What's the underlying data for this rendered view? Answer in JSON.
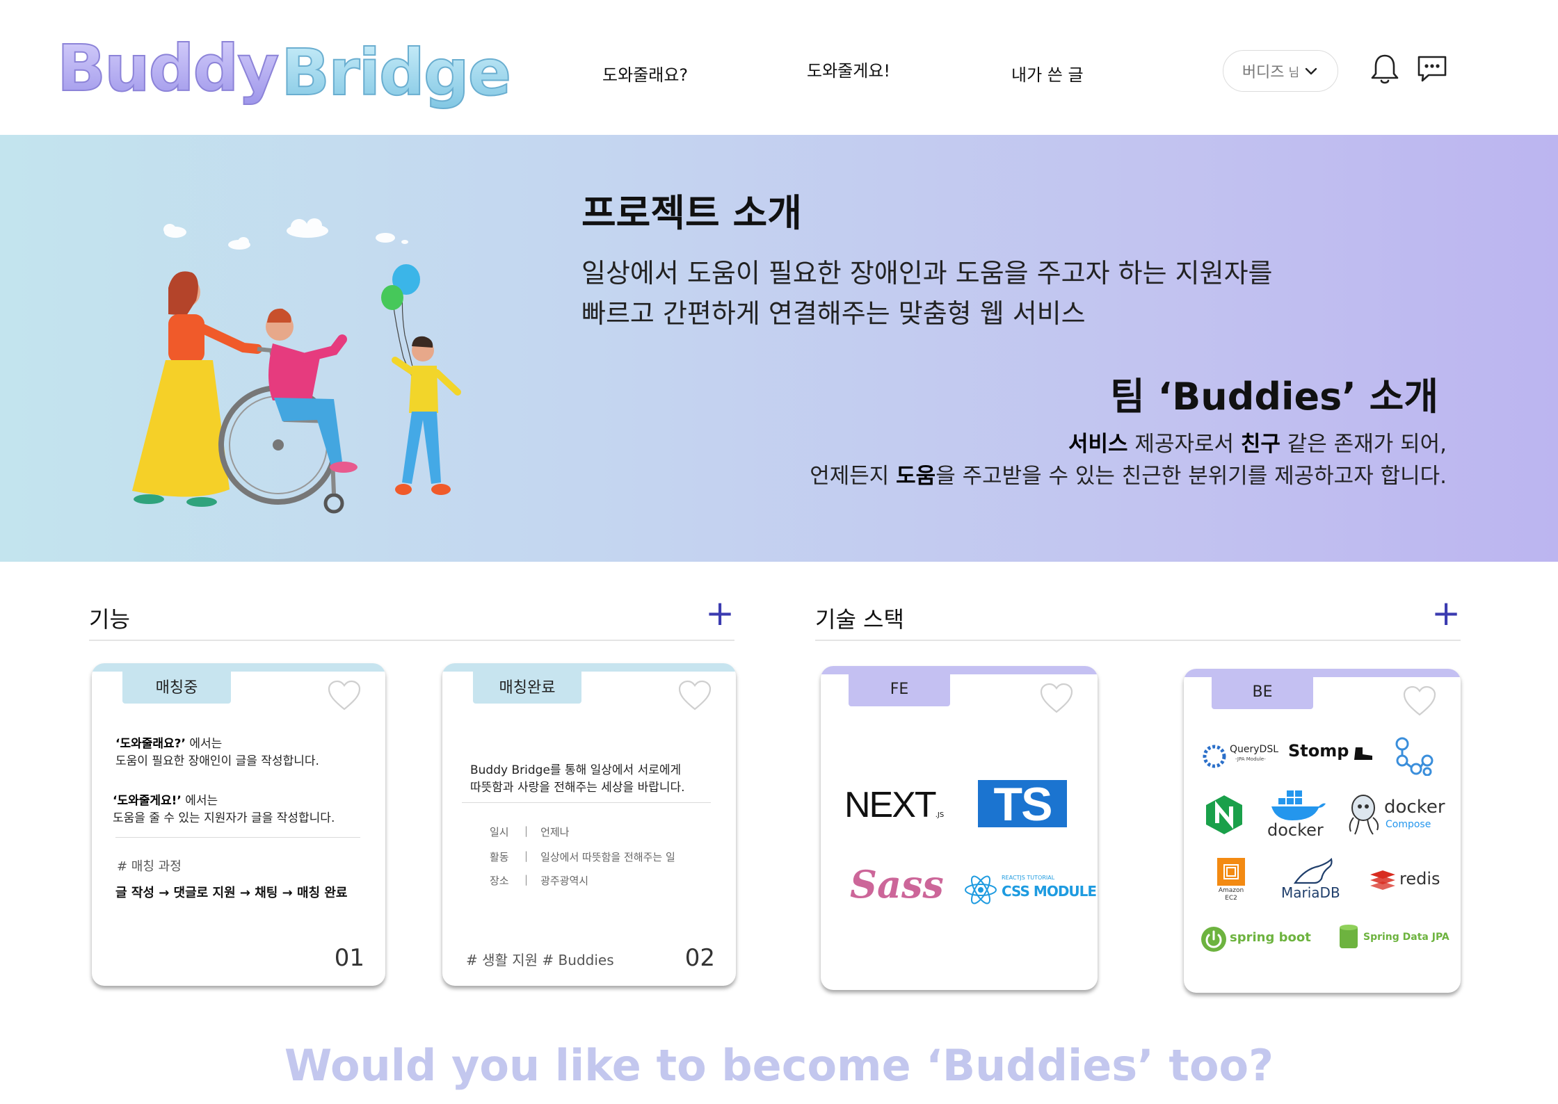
{
  "header": {
    "logo_text": "Buddy Bridge",
    "nav": [
      "도와줄래요?",
      "도와줄게요!",
      "내가 쓴 글"
    ],
    "user_label": "버디즈",
    "user_suffix": "님"
  },
  "hero": {
    "title": "프로젝트 소개",
    "desc_line1": "일상에서 도움이 필요한 장애인과 도움을 주고자 하는 지원자를",
    "desc_line2": "빠르고 간편하게 연결해주는 맞춤형 웹 서비스",
    "team_title": "팀 ‘Buddies’ 소개",
    "team_line1_b1": "서비스",
    "team_line1_t1": " 제공자로서 ",
    "team_line1_b2": "친구",
    "team_line1_t2": " 같은 존재가 되어,",
    "team_line2_t1": "언제든지 ",
    "team_line2_b1": "도움",
    "team_line2_t2": "을 주고받을 수 있는 친근한 분위기를 제공하고자 합니다."
  },
  "features": {
    "title": "기능",
    "plus": "+",
    "card1": {
      "tag": "매칭중",
      "q1_bold": "‘도와줄래요?’",
      "q1_suffix": " 에서는",
      "q1_desc": "도움이 필요한 장애인이 글을 작성합니다.",
      "q2_bold": "‘도와줄게요!’",
      "q2_suffix": " 에서는",
      "q2_desc": "도움을 줄 수 있는 지원자가 글을 작성합니다.",
      "process_label": "# 매칭 과정",
      "process_steps": "글 작성 → 댓글로 지원 → 채팅 → 매칭 완료",
      "number": "01"
    },
    "card2": {
      "tag": "매칭완료",
      "line1": "Buddy Bridge를 통해 일상에서 서로에게",
      "line2": "따뜻함과 사랑을 전해주는 세상을 바랍니다.",
      "rows": [
        {
          "k": "일시",
          "v": "언제나"
        },
        {
          "k": "활동",
          "v": "일상에서 따뜻함을 전해주는 일"
        },
        {
          "k": "장소",
          "v": "광주광역시"
        }
      ],
      "tags": "# 생활 지원 # Buddies",
      "number": "02"
    }
  },
  "stack": {
    "title": "기술 스택",
    "plus": "+",
    "fe": {
      "tag": "FE",
      "logos": {
        "next_main": "NEXT",
        "next_sub": ".JS",
        "ts": "TS",
        "sass": "Sass",
        "react_small": "REACTJS TUTORIAL",
        "react_main": "CSS MODULE"
      }
    },
    "be": {
      "tag": "BE",
      "logos": {
        "querydsl": "QueryDSL",
        "querydsl_sub": "-JPA Module-",
        "stomp": "Stomp",
        "docker": "docker",
        "docker_compose": "docker",
        "compose": "Compose",
        "amazon": "Amazon",
        "ec2": "EC2",
        "mariadb": "MariaDB",
        "redis": "redis",
        "spring_boot": "spring boot",
        "spring_data": "Spring Data JPA"
      }
    }
  },
  "footer": {
    "banner": "Would you like to become ‘Buddies’ too?"
  },
  "colors": {
    "teal_tag": "#c7e4ef",
    "purple_tag": "#c4c0f2",
    "plus": "#3b3bb0",
    "banner": "#c3c7ee"
  }
}
